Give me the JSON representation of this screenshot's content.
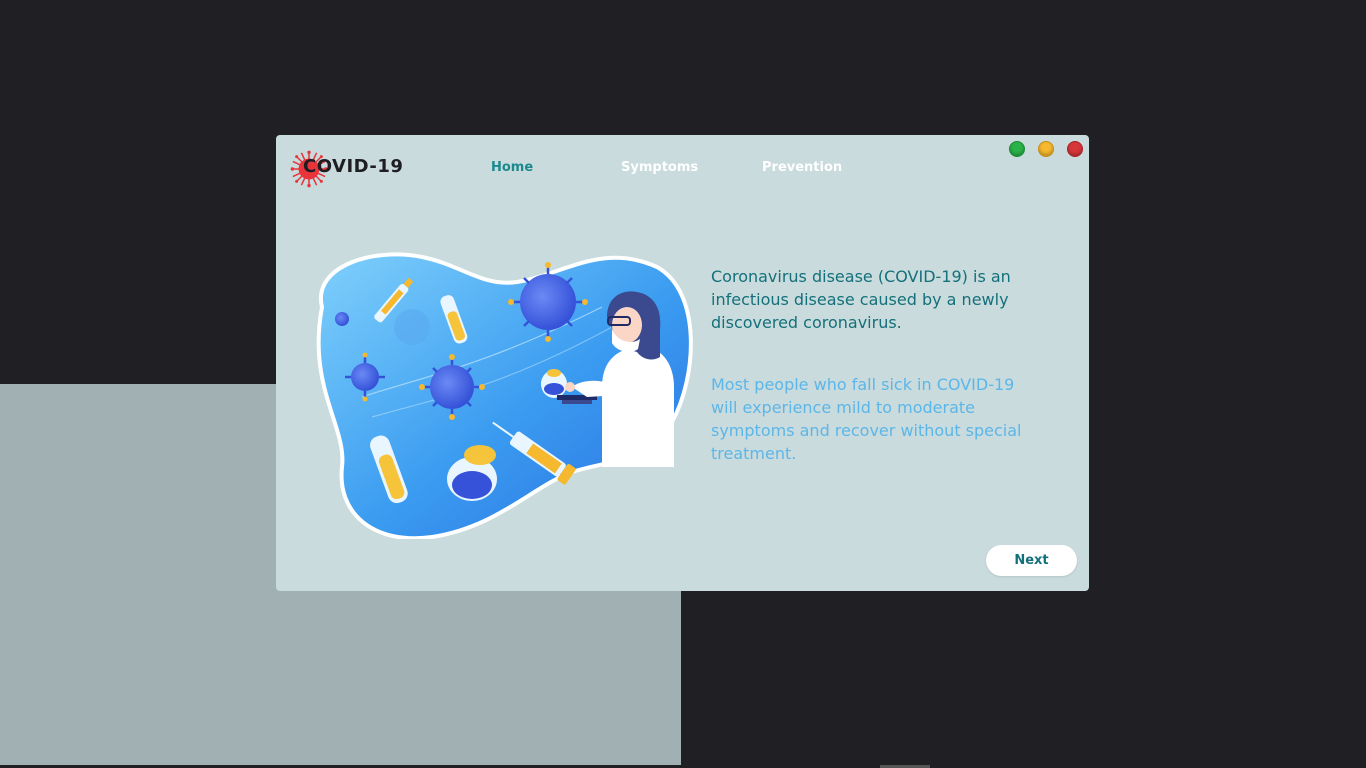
{
  "app": {
    "logo_text": "COVID-19"
  },
  "nav": {
    "items": [
      {
        "label": "Home",
        "active": true
      },
      {
        "label": "Symptoms",
        "active": false
      },
      {
        "label": "Prevention",
        "active": false
      }
    ]
  },
  "window_controls": {
    "green": "#2bb34a",
    "yellow": "#f5b82e",
    "red": "#d8373a"
  },
  "content": {
    "lead": "Coronavirus disease (COVID-19) is an infectious disease caused by a newly discovered coronavirus.",
    "secondary": "Most people who fall sick in COVID-19 will experience mild to moderate symptoms and recover without special treatment."
  },
  "actions": {
    "next_label": "Next"
  },
  "colors": {
    "window_bg": "#c9dbdd",
    "accent": "#14707a",
    "active_nav": "#1a8a8e",
    "secondary_text": "#5cb6e8",
    "desktop_bg": "#201f24"
  },
  "illustration": {
    "icon": "lab-scientist-virus-illustration"
  }
}
